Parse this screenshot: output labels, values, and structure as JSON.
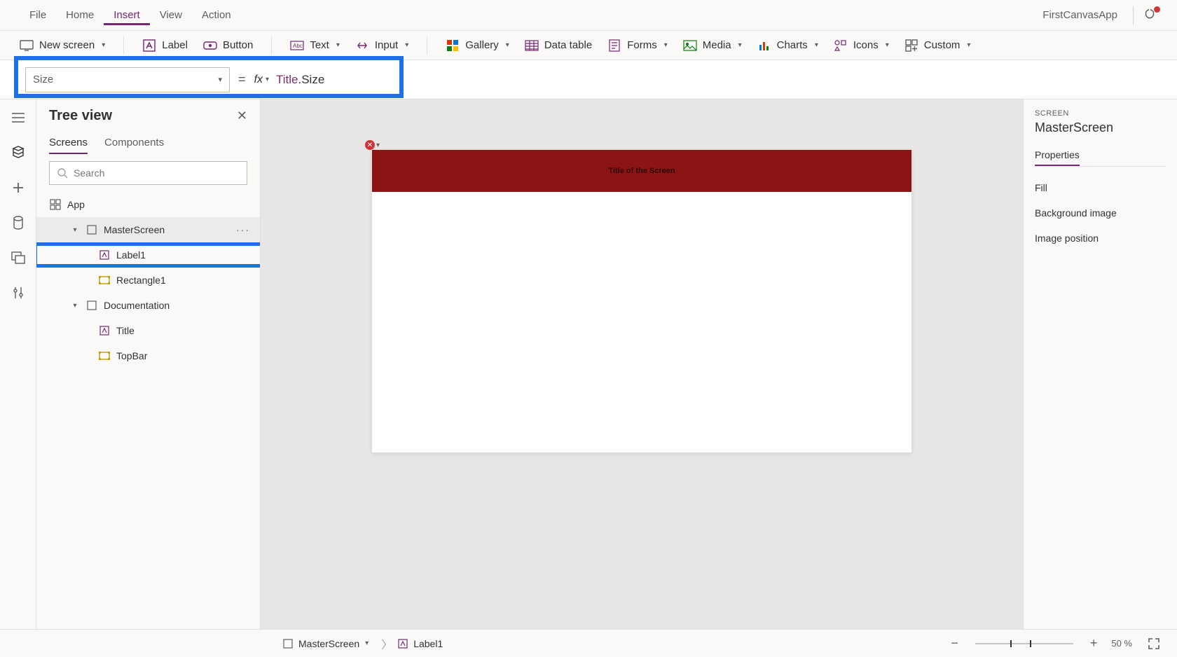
{
  "menu": {
    "items": [
      "File",
      "Home",
      "Insert",
      "View",
      "Action"
    ],
    "activeIndex": 2,
    "appName": "FirstCanvasApp"
  },
  "ribbon": {
    "newScreen": "New screen",
    "label": "Label",
    "button": "Button",
    "text": "Text",
    "input": "Input",
    "gallery": "Gallery",
    "dataTable": "Data table",
    "forms": "Forms",
    "media": "Media",
    "charts": "Charts",
    "icons": "Icons",
    "custom": "Custom"
  },
  "formula": {
    "property": "Size",
    "equals": "=",
    "fx": "fx",
    "token1": "Title",
    "token2": ".Size"
  },
  "tree": {
    "title": "Tree view",
    "tabs": {
      "screens": "Screens",
      "components": "Components"
    },
    "searchPlaceholder": "Search",
    "app": "App",
    "items": {
      "masterScreen": "MasterScreen",
      "label1": "Label1",
      "rectangle1": "Rectangle1",
      "documentation": "Documentation",
      "title": "Title",
      "topBar": "TopBar"
    }
  },
  "canvas": {
    "titleText": "Title of the Screen"
  },
  "rightPane": {
    "heading": "SCREEN",
    "selName": "MasterScreen",
    "tab": "Properties",
    "rows": {
      "fill": "Fill",
      "bg": "Background image",
      "imgPos": "Image position"
    }
  },
  "status": {
    "screen": "MasterScreen",
    "sel": "Label1",
    "zoomPct": "50  %"
  }
}
